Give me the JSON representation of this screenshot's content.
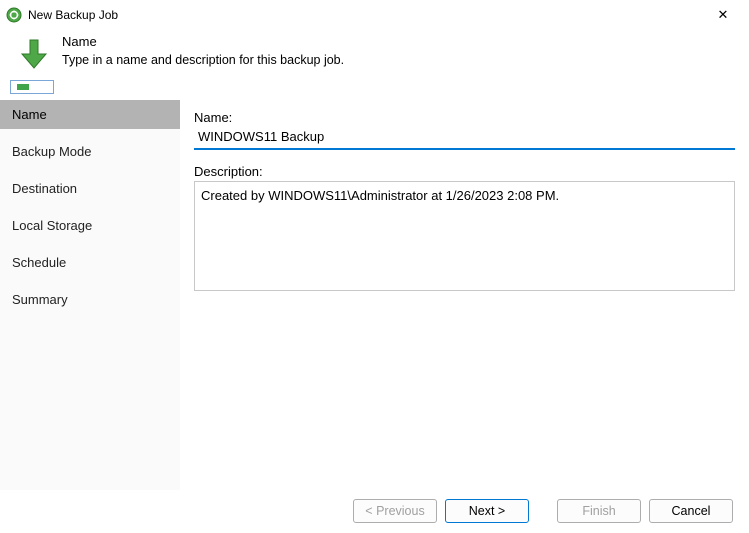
{
  "window": {
    "title": "New Backup Job",
    "close": "✕"
  },
  "header": {
    "title": "Name",
    "subtitle": "Type in a name and description for this backup job."
  },
  "sidebar": {
    "steps": [
      {
        "label": "Name",
        "active": true
      },
      {
        "label": "Backup Mode",
        "active": false
      },
      {
        "label": "Destination",
        "active": false
      },
      {
        "label": "Local Storage",
        "active": false
      },
      {
        "label": "Schedule",
        "active": false
      },
      {
        "label": "Summary",
        "active": false
      }
    ]
  },
  "form": {
    "name_label": "Name:",
    "name_value": "WINDOWS11 Backup",
    "desc_label": "Description:",
    "desc_value": "Created by WINDOWS11\\Administrator at 1/26/2023 2:08 PM."
  },
  "buttons": {
    "previous": "< Previous",
    "next": "Next >",
    "finish": "Finish",
    "cancel": "Cancel"
  }
}
